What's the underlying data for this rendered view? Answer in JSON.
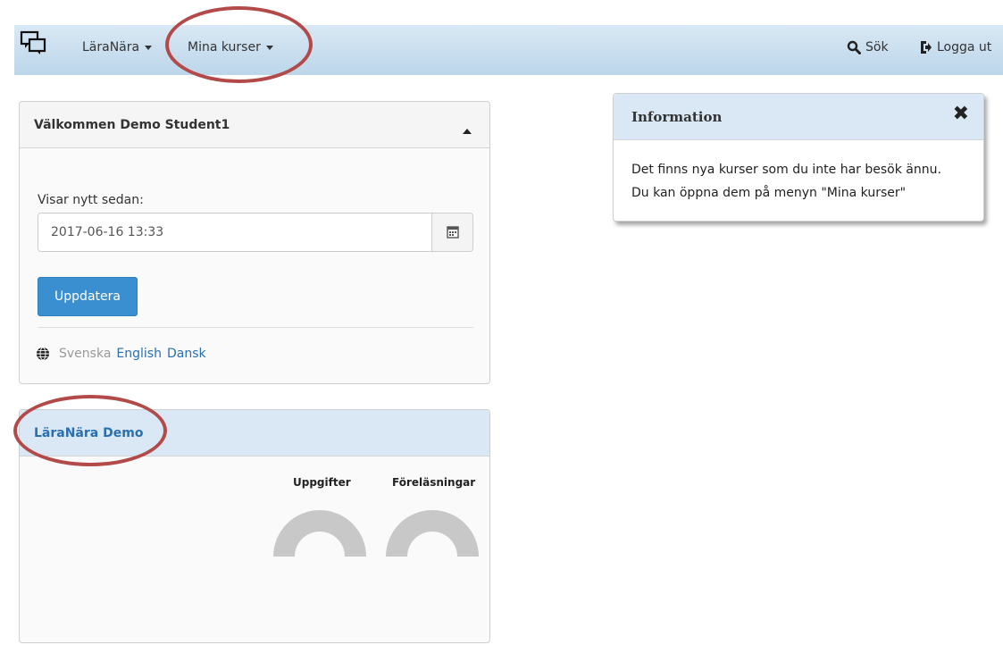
{
  "navbar": {
    "brand_icon": "chat-monitors-icon",
    "menu1_label": "LäraNära",
    "menu2_label": "Mina kurser",
    "search_label": "Sök",
    "logout_label": "Logga ut"
  },
  "welcome_panel": {
    "title": "Välkommen Demo Student1",
    "since_label": "Visar nytt sedan:",
    "since_value": "2017-06-16 13:33",
    "update_button": "Uppdatera",
    "languages": {
      "current": "Svenska",
      "other1": "English",
      "other2": "Dansk"
    }
  },
  "course_panel": {
    "title": "LäraNära Demo",
    "stat1_label": "Uppgifter",
    "stat2_label": "Föreläsningar"
  },
  "info_panel": {
    "title": "Information",
    "line1": "Det finns nya kurser som du inte har besök ännu.",
    "line2": "Du kan öppna dem på menyn \"Mina kurser\""
  },
  "colors": {
    "navbar": "#c9dfef",
    "primary": "#3a8fd1",
    "link": "#2a6fb0",
    "annotation": "#b34a4a",
    "gauge": "#c8c8c8"
  }
}
